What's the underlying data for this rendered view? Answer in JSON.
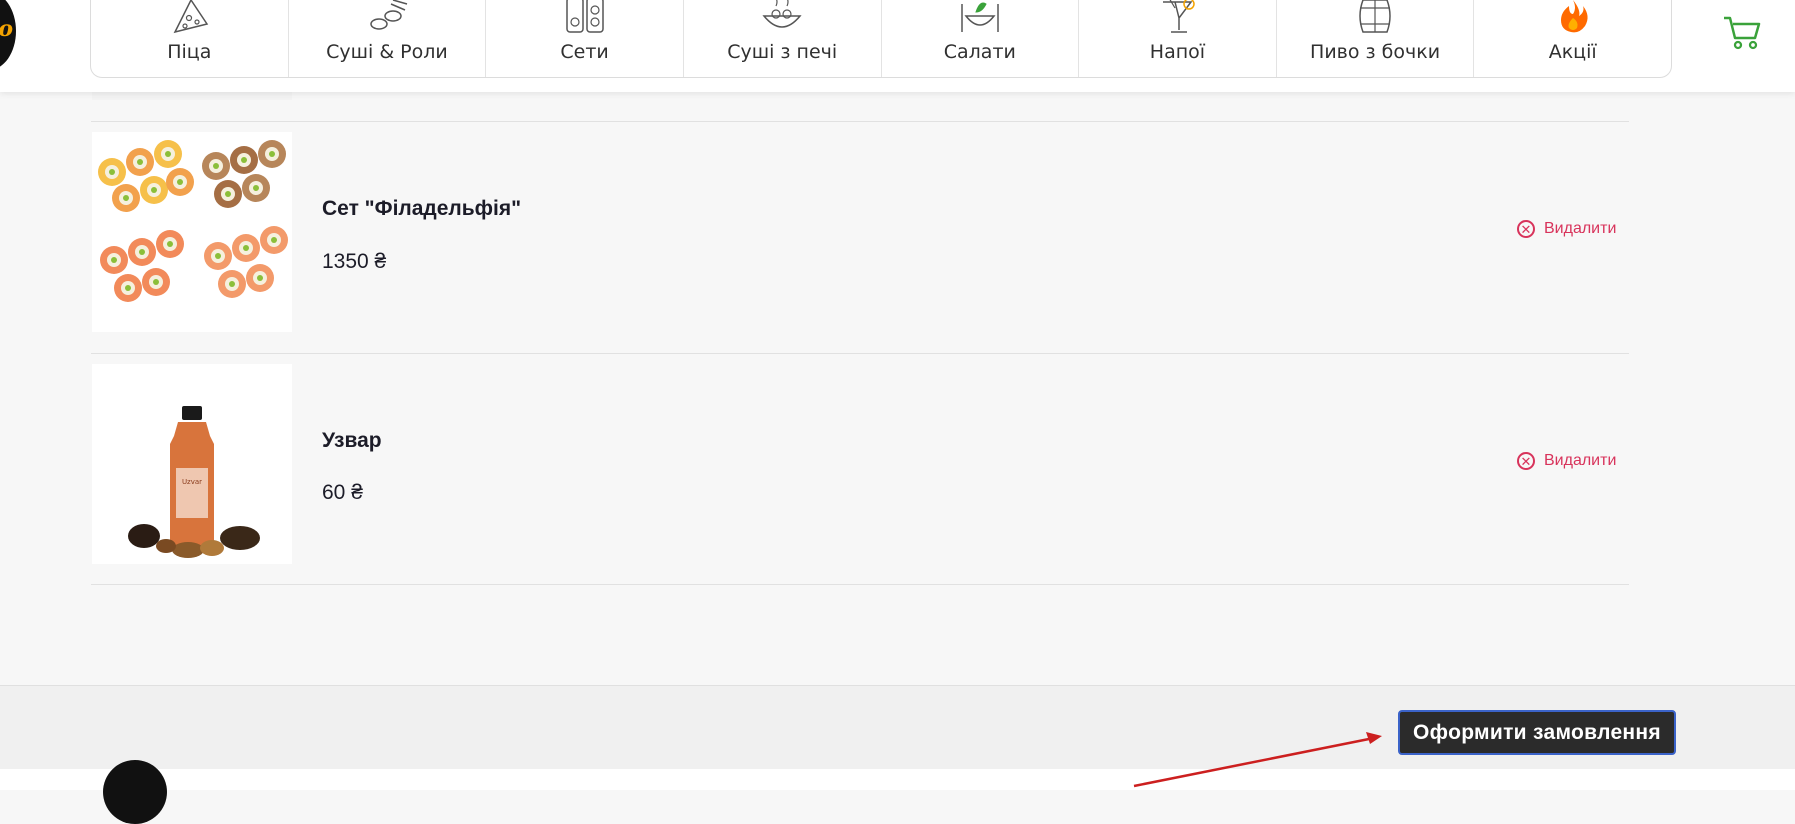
{
  "header": {
    "logo_text": "ro",
    "nav": [
      {
        "label": "Піца",
        "icon": "pizza-icon"
      },
      {
        "label": "Суші & Роли",
        "icon": "sushi-roll-icon"
      },
      {
        "label": "Сети",
        "icon": "sushi-set-icon"
      },
      {
        "label": "Суші з печі",
        "icon": "baked-sushi-icon"
      },
      {
        "label": "Салати",
        "icon": "salad-icon"
      },
      {
        "label": "Напої",
        "icon": "drink-icon"
      },
      {
        "label": "Пиво з бочки",
        "icon": "beer-barrel-icon"
      },
      {
        "label": "Акції",
        "icon": "fire-icon"
      }
    ],
    "cart_icon": "cart-icon",
    "colors": {
      "cart": "#3aa23a",
      "fire": "#ff6a00"
    }
  },
  "cart": {
    "items": [
      {
        "name": "Сет \"Філадельфія\"",
        "price": "1350 ₴",
        "remove_label": "Видалити",
        "image": "sushi-set-philadelphia"
      },
      {
        "name": "Узвар",
        "price": "60 ₴",
        "remove_label": "Видалити",
        "image": "uzvar-bottle"
      }
    ],
    "remove_color": "#d8335b"
  },
  "footer": {
    "order_button": "Оформити замовлення",
    "order_button_border": "#3b63c9"
  }
}
